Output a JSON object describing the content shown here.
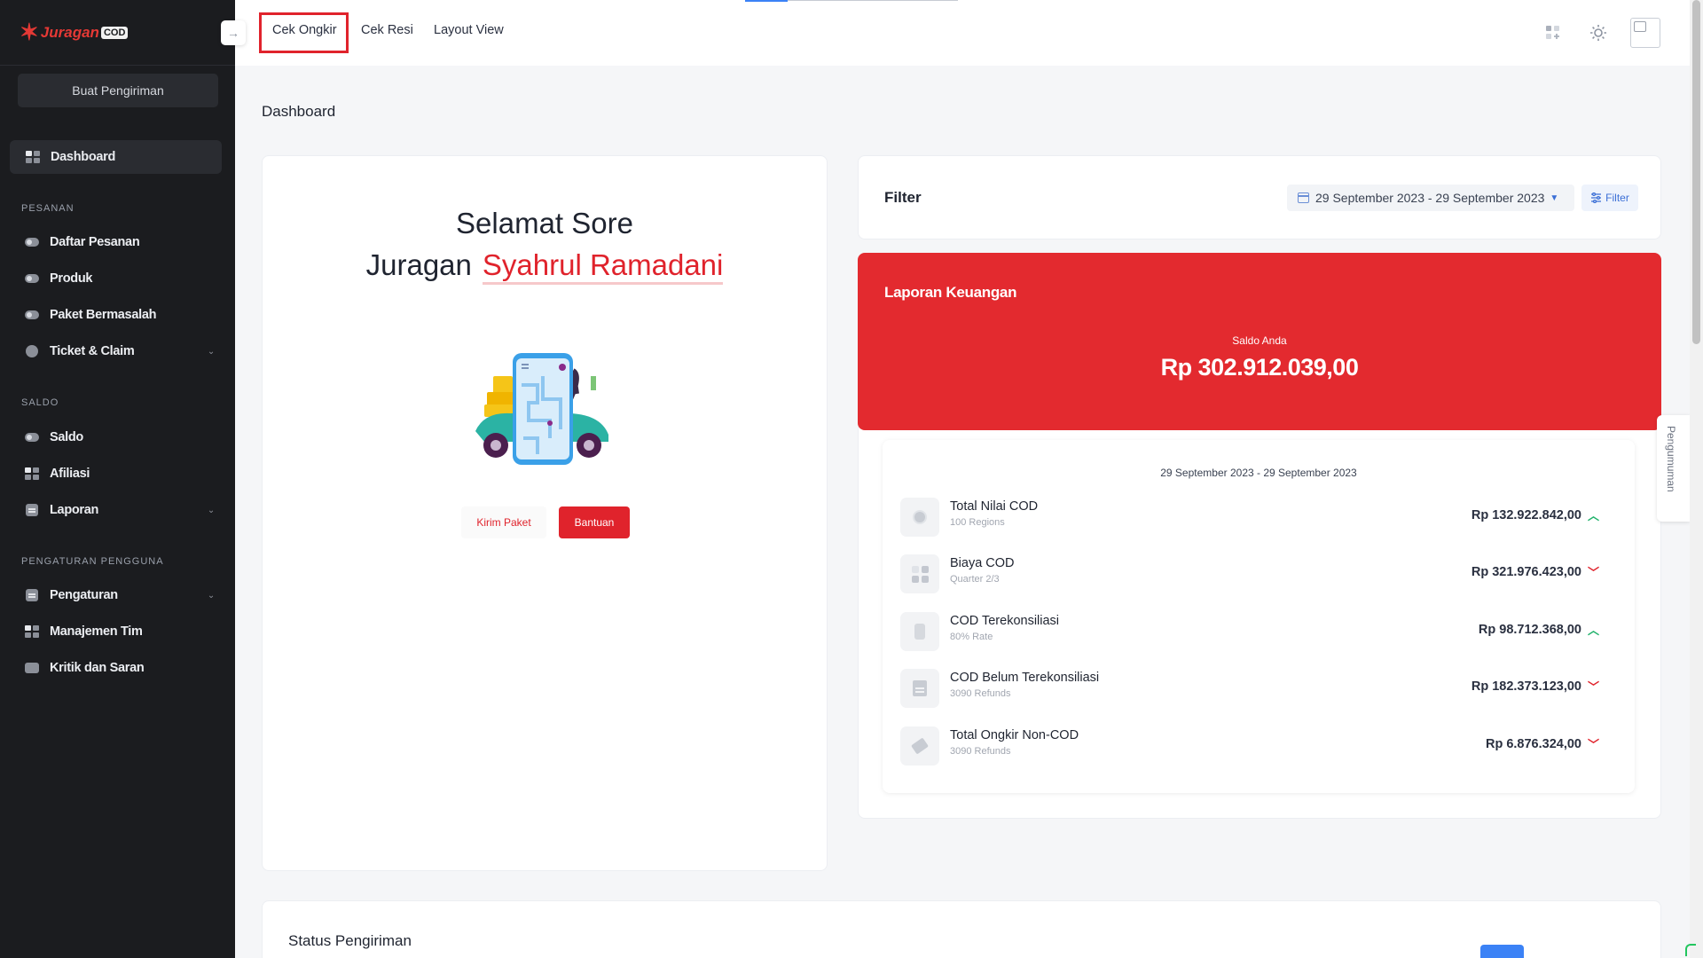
{
  "brand": {
    "name": "Juragan",
    "suffix": "COD"
  },
  "sidebar": {
    "create_button": "Buat Pengiriman",
    "active_item": "Dashboard",
    "sections": [
      {
        "title": "PESANAN",
        "items": [
          "Daftar Pesanan",
          "Produk",
          "Paket Bermasalah",
          "Ticket & Claim"
        ]
      },
      {
        "title": "SALDO",
        "items": [
          "Saldo",
          "Afiliasi",
          "Laporan"
        ]
      },
      {
        "title": "PENGATURAN PENGGUNA",
        "items": [
          "Pengaturan",
          "Manajemen Tim",
          "Kritik dan Saran"
        ]
      }
    ]
  },
  "topbar": {
    "tabs": [
      "Cek Ongkir",
      "Cek Resi",
      "Layout View"
    ],
    "highlighted_tab": "Cek Ongkir",
    "collapse_icon": "→",
    "icons": [
      "grid-plus-icon",
      "sun-icon",
      "avatar-image"
    ]
  },
  "page": {
    "title": "Dashboard"
  },
  "welcome": {
    "line1": "Selamat Sore",
    "line2_prefix": "Juragan",
    "user_name": "Syahrul Ramadani",
    "kirim_button": "Kirim Paket",
    "bantuan_button": "Bantuan"
  },
  "filter": {
    "title": "Filter",
    "date_range": "29 September 2023 - 29 September 2023",
    "filter_button": "Filter"
  },
  "finance": {
    "title": "Laporan Keuangan",
    "saldo_label": "Saldo Anda",
    "saldo_value": "Rp 302.912.039,00",
    "accent_color": "#e32a2f",
    "range": "29 September 2023 - 29 September 2023",
    "rows": [
      {
        "title": "Total Nilai COD",
        "subtitle": "100 Regions",
        "value": "Rp 132.922.842,00",
        "trend": "up"
      },
      {
        "title": "Biaya COD",
        "subtitle": "Quarter 2/3",
        "value": "Rp 321.976.423,00",
        "trend": "down"
      },
      {
        "title": "COD Terekonsiliasi",
        "subtitle": "80% Rate",
        "value": "Rp 98.712.368,00",
        "trend": "up"
      },
      {
        "title": "COD Belum Terekonsiliasi",
        "subtitle": "3090 Refunds",
        "value": "Rp 182.373.123,00",
        "trend": "down"
      },
      {
        "title": "Total Ongkir Non-COD",
        "subtitle": "3090 Refunds",
        "value": "Rp 6.876.324,00",
        "trend": "down"
      }
    ]
  },
  "status": {
    "title": "Status Pengiriman"
  },
  "announcement": {
    "label": "Pengumuman"
  }
}
